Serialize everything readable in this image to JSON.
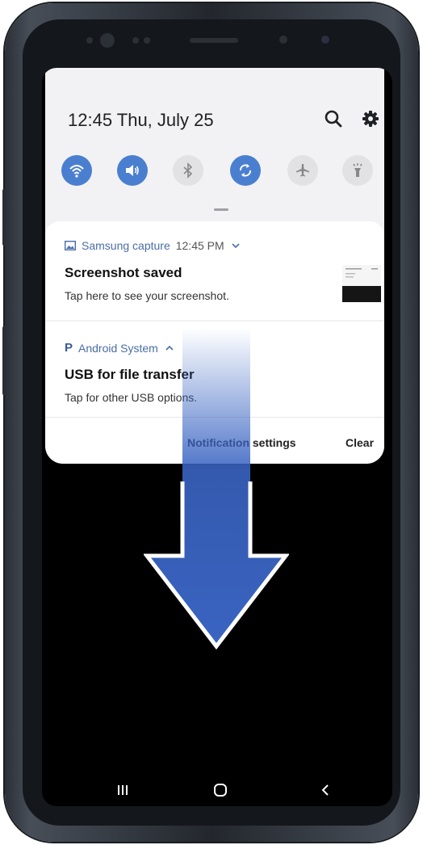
{
  "status_bar": {
    "time_date": "12:45  Thu, July 25"
  },
  "header_icons": [
    "search-icon",
    "gear-icon"
  ],
  "quick_settings": [
    {
      "name": "wifi",
      "active": true
    },
    {
      "name": "sound",
      "active": true
    },
    {
      "name": "bluetooth",
      "active": false
    },
    {
      "name": "auto-rotate",
      "active": true
    },
    {
      "name": "airplane-mode",
      "active": false
    },
    {
      "name": "flashlight",
      "active": false
    }
  ],
  "notifications": [
    {
      "app": "Samsung capture",
      "time": "12:45 PM",
      "title": "Screenshot saved",
      "text": "Tap here to see your screenshot."
    },
    {
      "app": "Android System",
      "title": "USB for file transfer",
      "text": "Tap for other USB options."
    }
  ],
  "actions": {
    "settings": "Notification settings",
    "clear": "Clear"
  },
  "nav_bar": [
    "recents",
    "home",
    "back"
  ],
  "colors": {
    "accent": "#4a7fd0",
    "arrow": "#3a64c2"
  }
}
